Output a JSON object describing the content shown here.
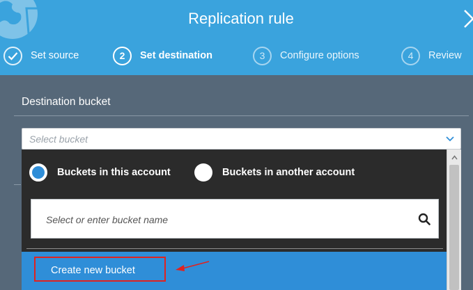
{
  "header": {
    "title": "Replication rule",
    "steps": [
      {
        "number": "",
        "label": "Set source",
        "state": "done"
      },
      {
        "number": "2",
        "label": "Set destination",
        "state": "active"
      },
      {
        "number": "3",
        "label": "Configure options",
        "state": "inactive"
      },
      {
        "number": "4",
        "label": "Review",
        "state": "inactive"
      }
    ]
  },
  "destination": {
    "section_label": "Destination bucket",
    "select_placeholder": "Select bucket",
    "radio_this_account": "Buckets in this account",
    "radio_another_account": "Buckets in another account",
    "search_placeholder": "Select or enter bucket name",
    "create_new_bucket": "Create new bucket"
  },
  "colors": {
    "header_bg": "#3aa3dd",
    "page_bg": "#566879",
    "dropdown_bg": "#2b2b2b",
    "accent_blue": "#2f8ed8",
    "annotation_red": "#e0221f"
  },
  "icons": [
    "logo-icon",
    "chevron-right-icon",
    "check-icon",
    "chevron-down-icon",
    "search-icon",
    "arrow-annotation"
  ]
}
